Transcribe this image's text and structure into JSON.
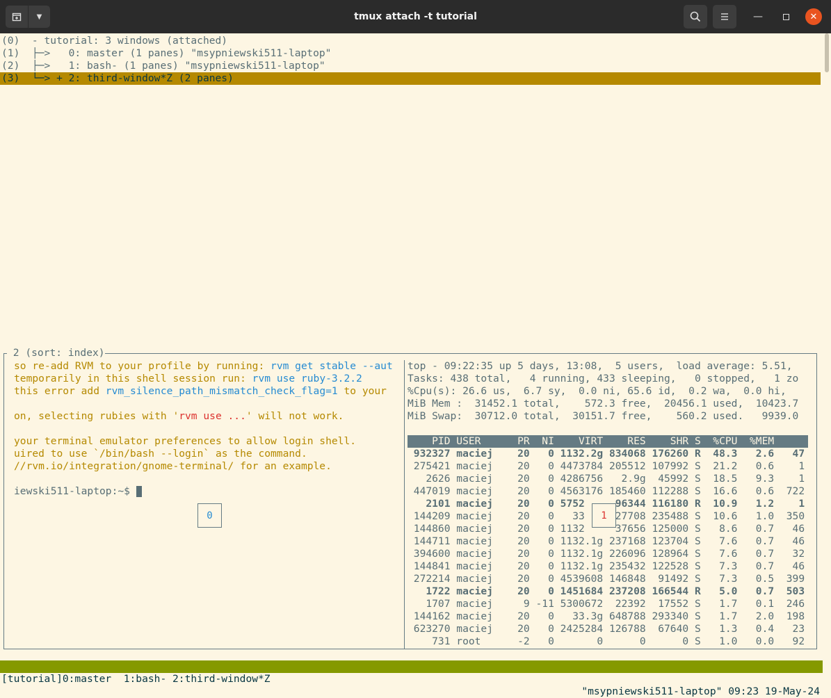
{
  "window": {
    "title": "tmux attach -t tutorial",
    "new_tab_icon": "new-tab-icon",
    "dropdown_icon": "chevron-down-icon",
    "search_icon": "search-icon",
    "menu_icon": "hamburger-icon"
  },
  "tree": {
    "line0": "(0)  - tutorial: 3 windows (attached)",
    "line1": "(1)  ├─>   0: master (1 panes) \"msypniewski511-laptop\"",
    "line2": "(2)  ├─>   1: bash- (1 panes) \"msypniewski511-laptop\"",
    "line3": "(3)  └─> + 2: third-window*Z (2 panes)"
  },
  "preview": {
    "label": " 2 (sort: index)",
    "left": {
      "l1a": "so re-add RVM to your profile by running: ",
      "l1b": "rvm get stable --aut",
      "l2a": "temporarily in this shell session run: ",
      "l2b": "rvm use ruby-3.2.2",
      "l3a": "this error add ",
      "l3b": "rvm_silence_path_mismatch_check_flag=1",
      "l3c": " to your",
      "l5a": "on, selecting rubies with '",
      "l5b": "rvm use ...",
      "l5c": "' will not work.",
      "l7": "your terminal emulator preferences to allow login shell.",
      "l8": "uired to use `/bin/bash --login` as the command.",
      "l9": "//rvm.io/integration/gnome-terminal/ for an example.",
      "prompt": "iewski511-laptop:~$ ",
      "pane_badge": "0"
    },
    "top": {
      "summary1": "top - 09:22:35 up 5 days, 13:08,  5 users,  load average: 5.51,",
      "summary2": "Tasks: 438 total,   4 running, 433 sleeping,   0 stopped,   1 zo",
      "summary3": "%Cpu(s): 26.6 us,  6.7 sy,  0.0 ni, 65.6 id,  0.2 wa,  0.0 hi,",
      "summary4": "MiB Mem :  31452.1 total,    572.3 free,  20456.1 used,  10423.7",
      "summary5": "MiB Swap:  30712.0 total,  30151.7 free,    560.2 used.   9939.0",
      "header": "    PID USER      PR  NI    VIRT    RES    SHR S  %CPU  %MEM",
      "pane_badge": "1",
      "rows": [
        {
          "text": " 932327 maciej    20   0 1132.2g 834068 176260 R  48.3   2.6   47",
          "bold": true
        },
        {
          "text": " 275421 maciej    20   0 4473784 205512 107992 S  21.2   0.6    1",
          "bold": false
        },
        {
          "text": "   2626 maciej    20   0 4286756   2.9g  45992 S  18.5   9.3    1",
          "bold": false
        },
        {
          "text": " 447019 maciej    20   0 4563176 185460 112288 S  16.6   0.6  722",
          "bold": false
        },
        {
          "text": "   2101 maciej    20   0 5752     96344 116180 R  10.9   1.2    1",
          "bold": true
        },
        {
          "text": " 144209 maciej    20   0   33     27708 235488 S  10.6   1.0  350",
          "bold": false
        },
        {
          "text": " 144860 maciej    20   0 1132     37656 125000 S   8.6   0.7   46",
          "bold": false
        },
        {
          "text": " 144711 maciej    20   0 1132.1g 237168 123704 S   7.6   0.7   46",
          "bold": false
        },
        {
          "text": " 394600 maciej    20   0 1132.1g 226096 128964 S   7.6   0.7   32",
          "bold": false
        },
        {
          "text": " 144841 maciej    20   0 1132.1g 235432 122528 S   7.3   0.7   46",
          "bold": false
        },
        {
          "text": " 272214 maciej    20   0 4539608 146848  91492 S   7.3   0.5  399",
          "bold": false
        },
        {
          "text": "   1722 maciej    20   0 1451684 237208 166544 R   5.0   0.7  503",
          "bold": true
        },
        {
          "text": "   1707 maciej     9 -11 5300672  22392  17552 S   1.7   0.1  246",
          "bold": false
        },
        {
          "text": " 144162 maciej    20   0   33.3g 648788 293340 S   1.7   2.0  198",
          "bold": false
        },
        {
          "text": " 623270 maciej    20   0 2425284 126788  67640 S   1.3   0.4   23",
          "bold": false
        },
        {
          "text": "    731 root      -2   0       0      0      0 S   1.0   0.0   92",
          "bold": false
        }
      ]
    }
  },
  "status": {
    "left": "[tutorial]0:master  1:bash- 2:third-window*Z",
    "right": "\"msypniewski511-laptop\" 09:23 19-May-24"
  },
  "colors": {
    "background": "#fdf6e3",
    "selection": "#b58900",
    "status_bar": "#859900",
    "close_button": "#e95420"
  }
}
